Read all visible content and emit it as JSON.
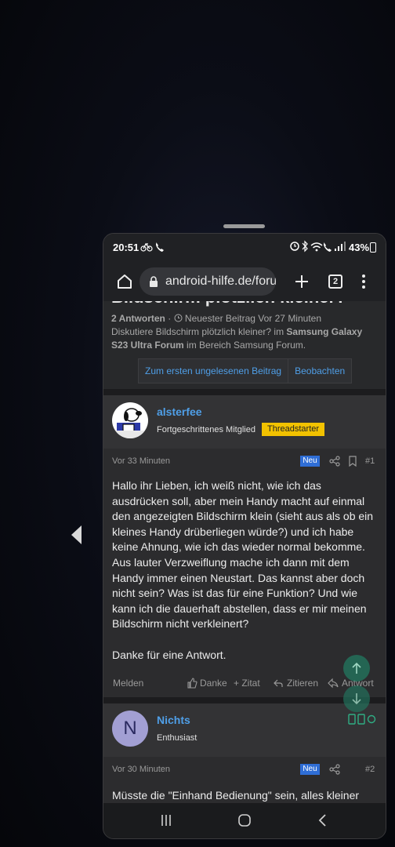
{
  "statusbar": {
    "time": "20:51",
    "battery": "43%"
  },
  "browser": {
    "url": "android-hilfe.de/forum",
    "tab_count": "2"
  },
  "thread": {
    "title": "Bildschirm plötzlich kleiner?",
    "replies": "2 Antworten",
    "newest_label": "Neuester Beitrag Vor 27 Minuten",
    "desc_prefix": "Diskutiere Bildschirm plötzlich kleiner? im ",
    "forum_name": "Samsung Galaxy S23 Ultra Forum",
    "desc_suffix": " im Bereich Samsung Forum.",
    "btn_unread": "Zum ersten ungelesenen Beitrag",
    "btn_watch": "Beobachten"
  },
  "posts": [
    {
      "username": "alsterfee",
      "role": "Fortgeschrittenes Mitglied",
      "badge": "Threadstarter",
      "time": "Vor 33 Minuten",
      "new_badge": "Neu",
      "number": "#1",
      "text": "Hallo ihr Lieben, ich weiß nicht, wie ich das ausdrücken soll, aber mein Handy macht auf einmal den angezeigten Bildschirm klein (sieht aus als ob ein kleines Handy drüberliegen würde?) und ich habe keine Ahnung, wie ich das wieder normal bekomme. Aus lauter Verzweiflung mache ich dann mit dem Handy immer einen Neustart. Das kannst aber doch nicht sein? Was ist das für eine Funktion? Und wie kann ich die dauerhaft abstellen, dass er mir meinen Bildschirm nicht verkleinert?\n\nDanke für eine Antwort.",
      "actions": {
        "report": "Melden",
        "like": "Danke",
        "quote": "+ Zitat",
        "multiquote": "Zitieren",
        "reply": "Antwort"
      }
    },
    {
      "username": "Nichts",
      "avatar_letter": "N",
      "role": "Enthusiast",
      "time": "Vor 30 Minuten",
      "new_badge": "Neu",
      "number": "#2",
      "text": "Müsste die \"Einhand Bedienung\" sein, alles kleiner"
    }
  ],
  "colors": {
    "accent": "#4f9fe8",
    "badge": "#f2c200",
    "new": "#2f6ed6"
  }
}
